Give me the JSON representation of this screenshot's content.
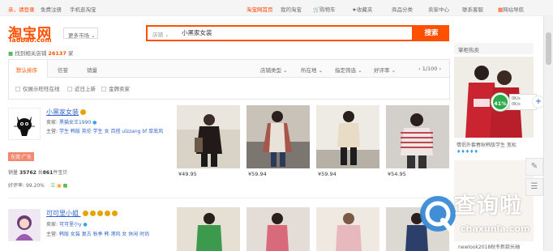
{
  "topbar": {
    "greeting": "亲，请登录",
    "free_register": "免费注册",
    "mobile": "手机逛淘宝",
    "home": "淘宝网首页",
    "my_taobao": "我的淘宝",
    "cart": "购物车",
    "favorites": "收藏夹",
    "categories": "商品分类",
    "seller_center": "卖家中心",
    "service": "联系客服",
    "site_nav": "网站导航"
  },
  "header": {
    "logo": "淘宝网",
    "logo_sub": "Taobao.com",
    "more_market": "更多市场",
    "search_type": "店铺",
    "search_query": "小黑家女装",
    "search_button": "搜索"
  },
  "results": {
    "prefix": "找到相关店铺",
    "count": "26137",
    "suffix": "家"
  },
  "tabs": [
    {
      "label": "默认排序",
      "active": true
    },
    {
      "label": "信誉",
      "active": false
    },
    {
      "label": "销量",
      "active": false
    }
  ],
  "filters": {
    "shop_type": "店铺类型",
    "location": "所在地",
    "specific": "指定筛选",
    "rating": "好评率",
    "page": "1/100"
  },
  "checkboxes": [
    "仅展示旺旺在线",
    "近日上新",
    "金牌卖家"
  ],
  "shops": [
    {
      "name": "小黑家女装",
      "seller_label": "卖家:",
      "seller": "黑猫女王1990",
      "main_label": "主营:",
      "main": "学生 韩版 英伦 学生 女 百搭 ulzzang bf 厚底风",
      "location_badge": "东莞·广东",
      "sales_label": "销量",
      "sales": "35762",
      "items_label": "共",
      "items": "861",
      "items_suffix": "件宝贝",
      "rating_label": "好评率:",
      "rating": "99.20%",
      "products": [
        {
          "price": "¥49.95"
        },
        {
          "price": "¥59.94"
        },
        {
          "price": "¥59.94"
        },
        {
          "price": "¥54.95"
        }
      ]
    },
    {
      "name": "可可里小姐",
      "seller_label": "卖家:",
      "seller": "可可里小y",
      "main_label": "主营:",
      "main": "韩版 女装 复古 秋季 韩 港风 女 休闲 时尚"
    }
  ],
  "right_column": {
    "header": "掌柜热卖",
    "caption1": "情侣外套春秋韩版学生 宽松",
    "caption2": "newlook2018秋冬新款长袖",
    "speed_percent": "41%",
    "speed_up": "0K/s",
    "speed_down": "0K/s"
  },
  "watermark": {
    "text": "查询啦",
    "url": "chaxunla.com"
  },
  "colors": {
    "brand": "#ff5000",
    "link": "#3366cc"
  }
}
